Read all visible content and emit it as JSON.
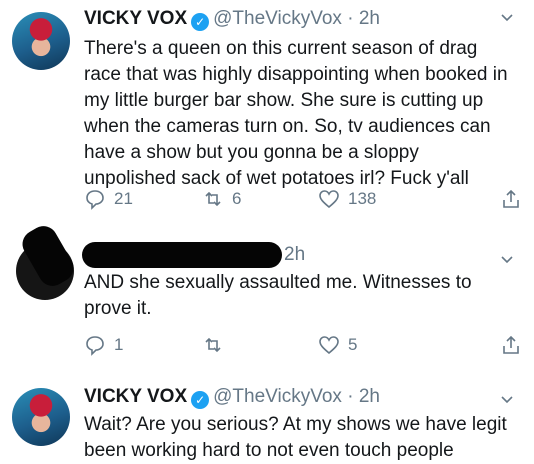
{
  "tweets": [
    {
      "name": "VICKY VOX",
      "handle": "@TheVickyVox",
      "dot": "·",
      "time": "2h",
      "text": "There's a queen on this current season of drag race that was highly disappointing when booked in my little burger bar show. She sure is cutting up when the cameras turn on. So, tv audiences can have a show but you gonna be a sloppy unpolished sack of wet potatoes irl? Fuck y'all",
      "replies": "21",
      "retweets": "6",
      "likes": "138"
    },
    {
      "time": "2h",
      "text": "AND she sexually assaulted me. Witnesses to prove it.",
      "replies": "1",
      "retweets": "",
      "likes": "5"
    },
    {
      "name": "VICKY VOX",
      "handle": "@TheVickyVox",
      "dot": "·",
      "time": "2h",
      "text": "Wait? Are you serious? At my shows we have legit been working hard to not even touch people"
    }
  ],
  "icons": {
    "reply": "reply-icon",
    "retweet": "retweet-icon",
    "like": "heart-icon",
    "share": "share-icon",
    "more": "chevron-down-icon",
    "verified": "verified-badge-icon"
  },
  "colors": {
    "verified": "#1da1f2",
    "meta": "#657786",
    "text": "#14171a"
  }
}
